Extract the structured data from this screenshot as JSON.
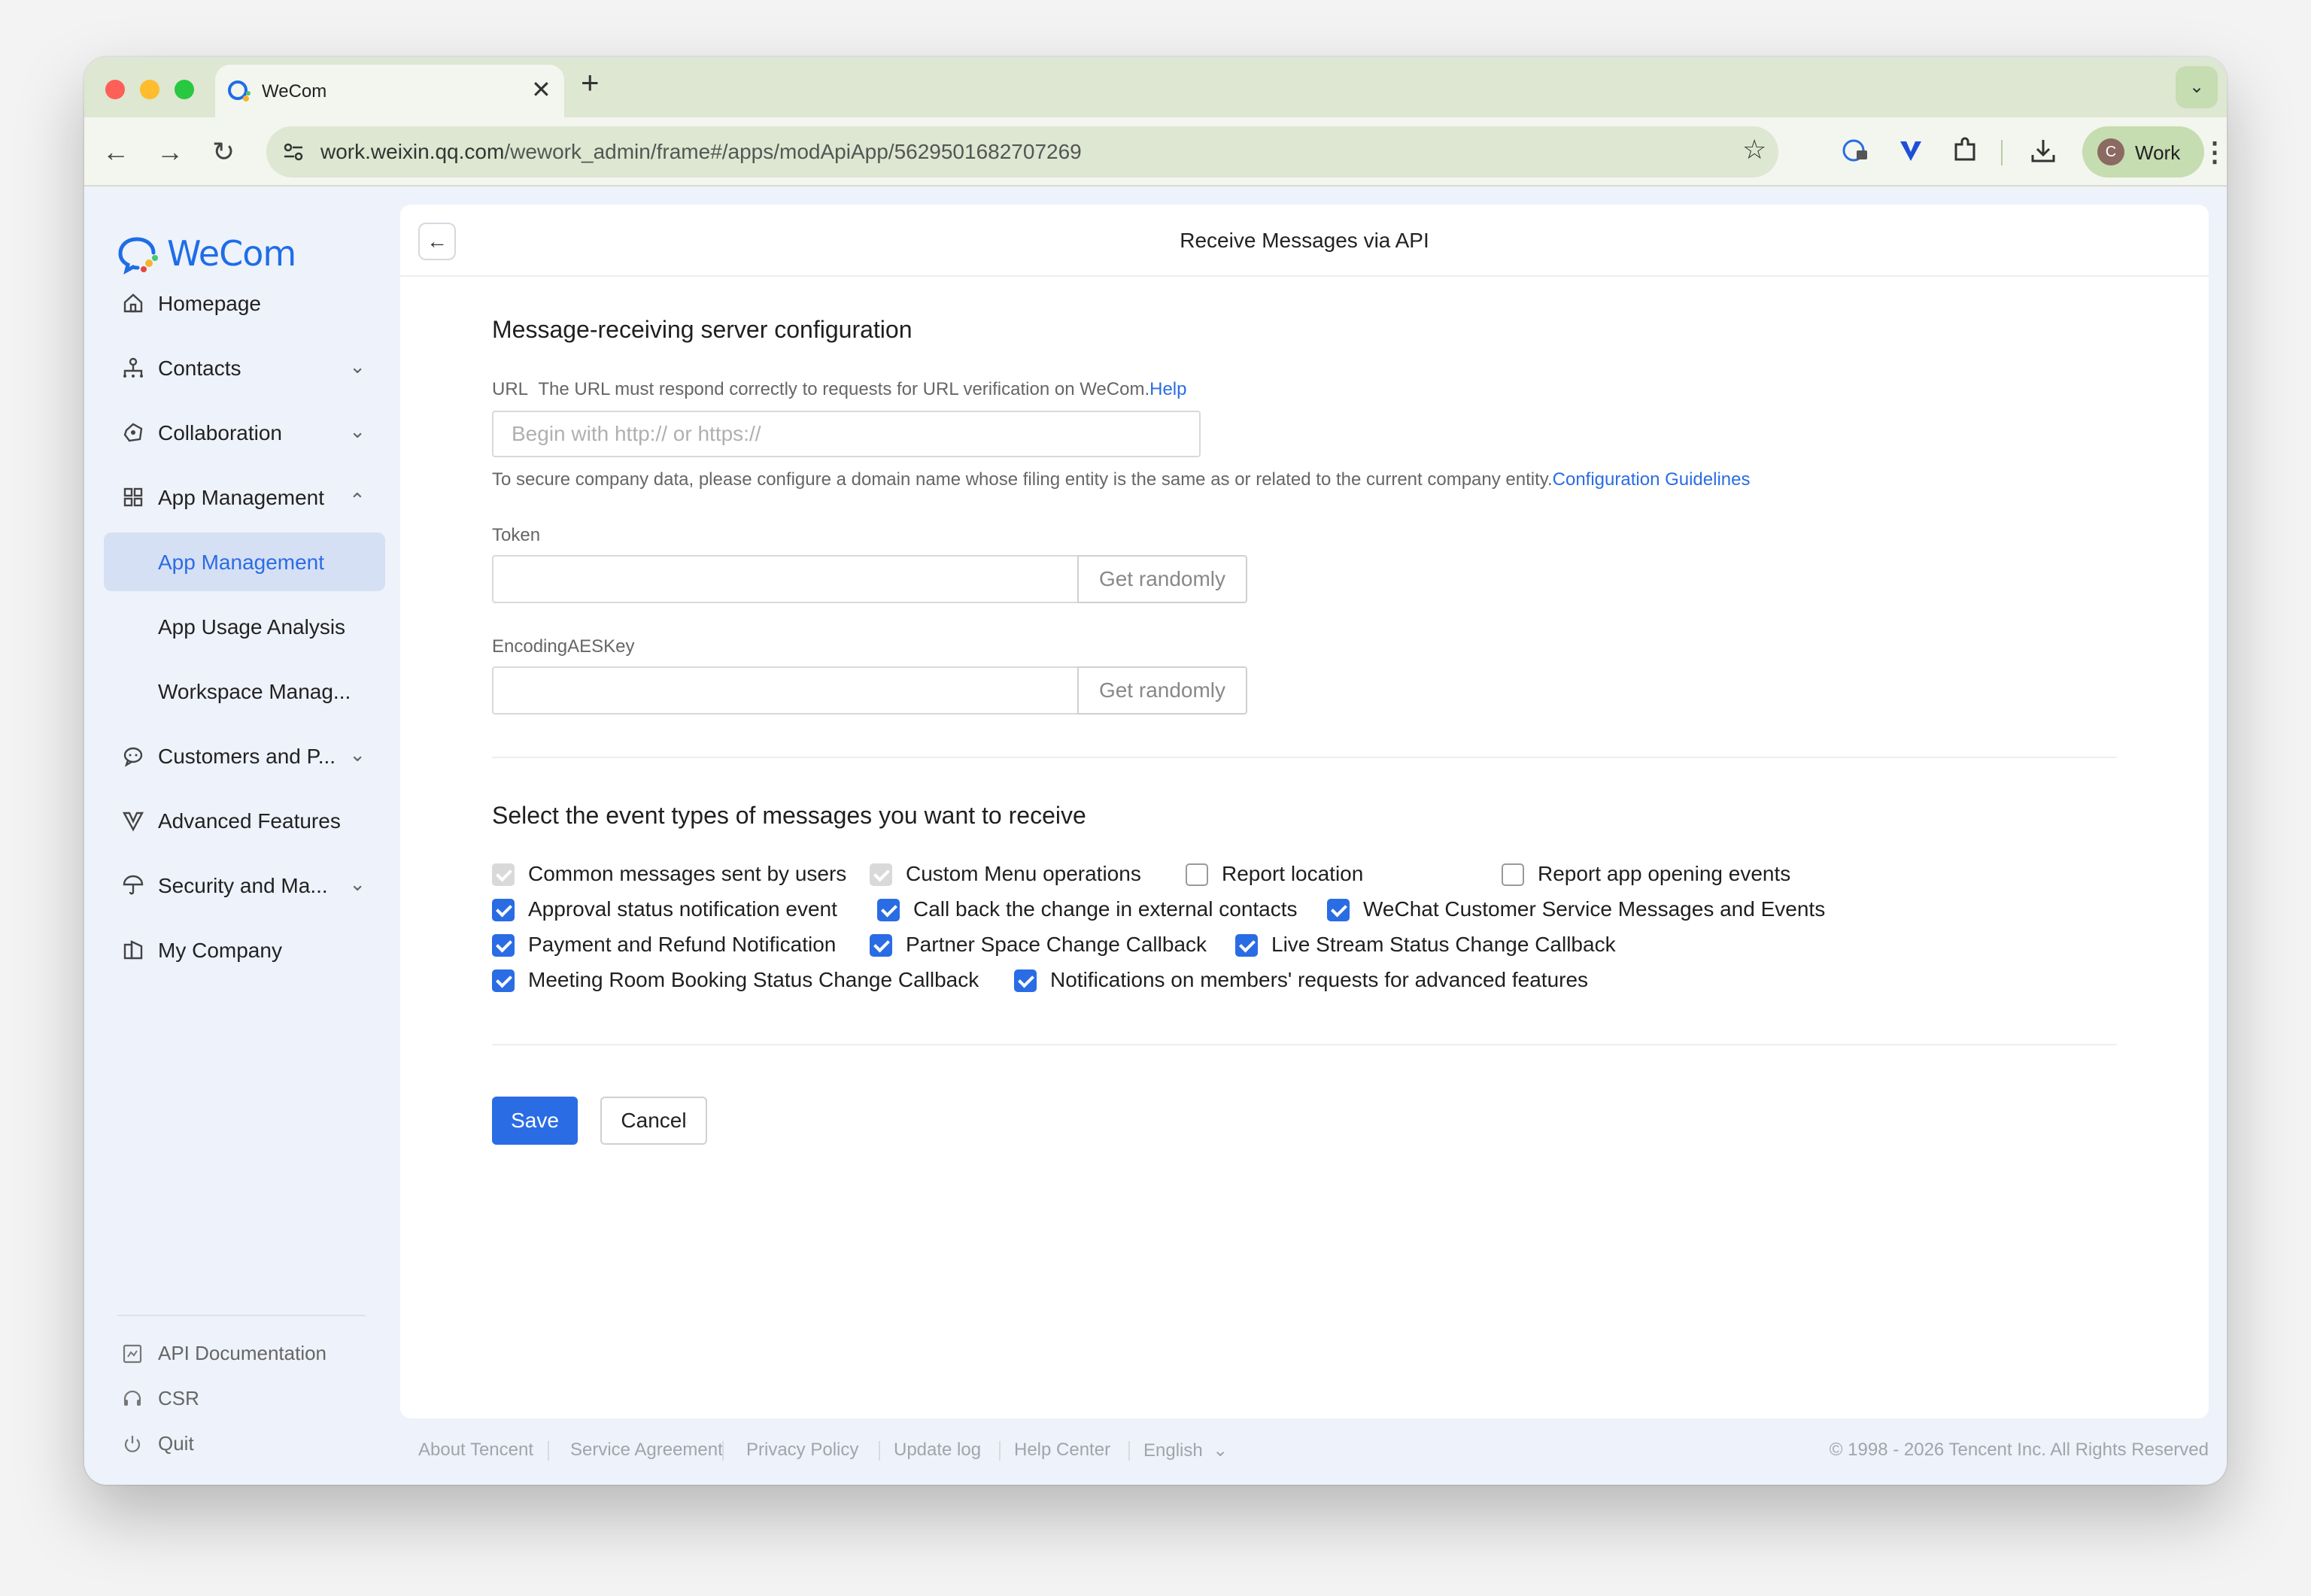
{
  "browser": {
    "tab_title": "WeCom",
    "url_host": "work.weixin.qq.com",
    "url_path": "/wework_admin/frame#/apps/modApiApp/5629501682707269",
    "profile_initial": "C",
    "profile_name": "Work",
    "colors": {
      "tabbar": "#dde7d1",
      "accent": "#c6dcb1"
    }
  },
  "sidebar": {
    "brand": "WeCom",
    "items": [
      {
        "label": "Homepage",
        "icon": "home-icon"
      },
      {
        "label": "Contacts",
        "icon": "org-chart-icon",
        "expandable": true
      },
      {
        "label": "Collaboration",
        "icon": "collaboration-icon",
        "expandable": true
      },
      {
        "label": "App Management",
        "icon": "grid-icon",
        "expanded": true
      },
      {
        "label": "App Management",
        "active": true
      },
      {
        "label": "App Usage Analysis"
      },
      {
        "label": "Workspace Manag..."
      },
      {
        "label": "Customers and P...",
        "icon": "chat-bubble-icon",
        "expandable": true
      },
      {
        "label": "Advanced Features",
        "icon": "v-badge-icon"
      },
      {
        "label": "Security and Ma...",
        "icon": "umbrella-icon",
        "expandable": true
      },
      {
        "label": "My Company",
        "icon": "building-icon"
      }
    ],
    "footer": [
      {
        "label": "API Documentation",
        "icon": "document-icon"
      },
      {
        "label": "CSR",
        "icon": "headset-icon"
      },
      {
        "label": "Quit",
        "icon": "power-icon"
      }
    ]
  },
  "panel": {
    "title": "Receive Messages via API",
    "server_section_title": "Message-receiving server configuration",
    "url_label": "URL",
    "url_desc": "The URL must respond correctly to requests for URL verification on WeCom.",
    "url_help": "Help",
    "url_placeholder": "Begin with http:// or https://",
    "url_hint": "To secure company data, please configure a domain name whose filing entity is the same as or related to the current company entity.",
    "url_hint_link": "Configuration Guidelines",
    "token_label": "Token",
    "token_value": "",
    "aes_label": "EncodingAESKey",
    "aes_value": "",
    "get_randomly": "Get randomly",
    "events_title": "Select the event types of messages you want to receive",
    "events": [
      {
        "label": "Common messages sent by users",
        "state": "disabled-checked"
      },
      {
        "label": "Custom Menu operations",
        "state": "disabled-checked"
      },
      {
        "label": "Report location",
        "state": "unchecked"
      },
      {
        "label": "Report app opening events",
        "state": "unchecked"
      },
      {
        "label": "Approval status notification event",
        "state": "checked"
      },
      {
        "label": "Call back the change in external contacts",
        "state": "checked"
      },
      {
        "label": "WeChat Customer Service Messages and Events",
        "state": "checked"
      },
      {
        "label": "Payment and Refund Notification",
        "state": "checked"
      },
      {
        "label": "Partner Space Change Callback",
        "state": "checked"
      },
      {
        "label": "Live Stream Status Change Callback",
        "state": "checked"
      },
      {
        "label": "Meeting Room Booking Status Change Callback",
        "state": "checked"
      },
      {
        "label": "Notifications on members' requests for advanced features",
        "state": "checked"
      }
    ],
    "save": "Save",
    "cancel": "Cancel"
  },
  "footer": {
    "links": [
      "About Tencent",
      "Service Agreement",
      "Privacy Policy",
      "Update log",
      "Help Center",
      "English"
    ],
    "copyright": "© 1998 - 2026 Tencent Inc. All Rights Reserved"
  }
}
